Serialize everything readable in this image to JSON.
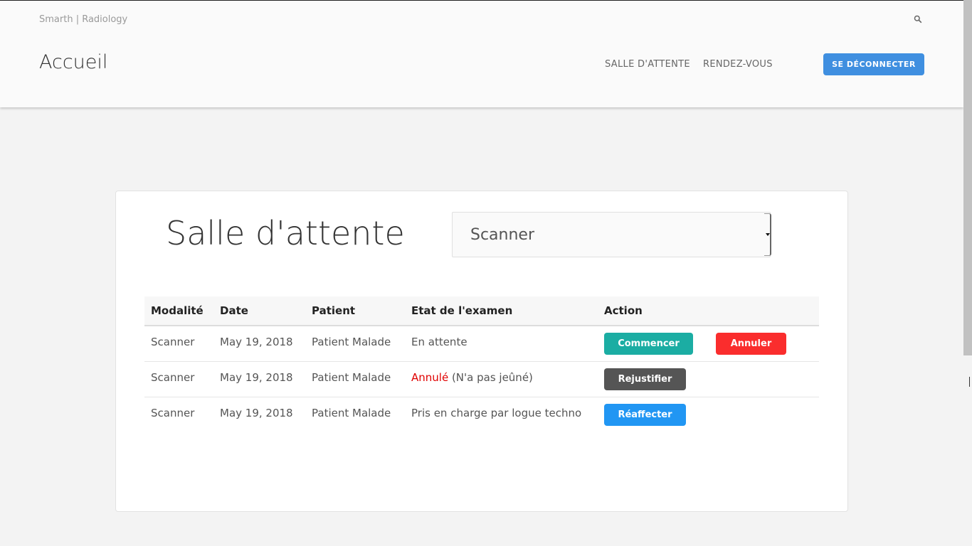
{
  "navbar": {
    "brand": "Smarth | Radiology",
    "page_title": "Accueil",
    "links": [
      {
        "label": "SALLE D'ATTENTE"
      },
      {
        "label": "RENDEZ-VOUS"
      }
    ],
    "logout_label": "SE DÉCONNECTER",
    "search_icon": "search-icon"
  },
  "main": {
    "title": "Salle d'attente",
    "modality_select": {
      "selected": "Scanner"
    },
    "table": {
      "headers": [
        "Modalité",
        "Date",
        "Patient",
        "Etat de l'examen",
        "Action"
      ],
      "rows": [
        {
          "modality": "Scanner",
          "date": "May 19, 2018",
          "patient": "Patient Malade",
          "status": "En attente",
          "actions": [
            "Commencer",
            "Annuler"
          ]
        },
        {
          "modality": "Scanner",
          "date": "May 19, 2018",
          "patient": "Patient Malade",
          "status": "Annulé",
          "status_note": " (N'a pas jeûné)",
          "actions": [
            "Rejustifier"
          ]
        },
        {
          "modality": "Scanner",
          "date": "May 19, 2018",
          "patient": "Patient Malade",
          "status": "Pris en charge par logue techno",
          "actions": [
            "Réaffecter"
          ]
        }
      ]
    }
  },
  "colors": {
    "primary": "#3f8fe0",
    "start": "#1bada3",
    "cancel": "#fa2d2d",
    "rejustify": "#555555",
    "reassign": "#2196f3",
    "cancelled_status": "#e00000"
  }
}
